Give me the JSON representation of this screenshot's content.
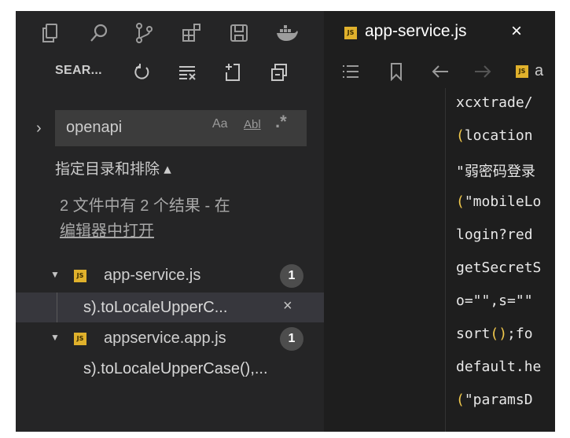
{
  "activity_bar": {
    "icons": [
      "explorer-icon",
      "search-icon",
      "source-control-icon",
      "extensions-icon",
      "remote-explorer-icon",
      "docker-icon"
    ]
  },
  "sidebar": {
    "title": "SEAR...",
    "header_icons": [
      "refresh-icon",
      "clear-results-icon",
      "new-search-editor-icon",
      "collapse-all-icon"
    ],
    "search": {
      "value": "openapi",
      "match_case_label": "Aa",
      "whole_word_label": "Abl",
      "regex_label": ".*"
    },
    "include_exclude_label": "指定目录和排除 ▴",
    "result_summary": "2 文件中有 2 个结果 - 在",
    "open_in_editor_label": "编辑器中打开",
    "files": [
      {
        "name": "app-service.js",
        "icon_text": "JS",
        "count": "1",
        "match": "s).toLocaleUpperC...",
        "match_close": "×"
      },
      {
        "name": "appservice.app.js",
        "icon_text": "JS",
        "count": "1",
        "match": "s).toLocaleUpperCase(),..."
      }
    ]
  },
  "tab": {
    "icon_text": "JS",
    "label": "app-service.js",
    "close": "×"
  },
  "breadcrumb": {
    "file_icon_text": "JS",
    "file_start": "a"
  },
  "editor": {
    "lines": [
      "xcxtrade/",
      "(location",
      "\"弱密码登录",
      "(\"mobileLo",
      "login?red",
      "getSecretS",
      "o=\"\",s=\"\"",
      "sort();fo",
      "default.he",
      "(\"paramsD"
    ]
  },
  "colors": {
    "background": "#1e1e1e",
    "sidebar": "#252526",
    "js_icon": "#e0b12c",
    "selected_row": "#37373d"
  }
}
